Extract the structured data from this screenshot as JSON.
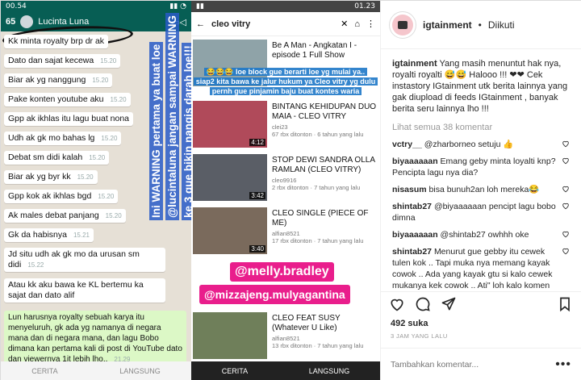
{
  "wa": {
    "time": "00.54",
    "title_num": "65",
    "contact": "Lucinta Luna",
    "messages": [
      {
        "text": "Kk minta royalty brp dr ak",
        "time": ""
      },
      {
        "text": "Dato dan sajat kecewa",
        "time": "15.20"
      },
      {
        "text": "Biar ak yg nanggung",
        "time": "15.20"
      },
      {
        "text": "Pake konten youtube aku",
        "time": "15.20"
      },
      {
        "text": "Gpp ak ikhlas itu lagu buat nona",
        "time": ""
      },
      {
        "text": "Udh ak gk mo bahas lg",
        "time": "15.20"
      },
      {
        "text": "Debat sm didi kalah",
        "time": "15.20"
      },
      {
        "text": "Biar ak yg byr kk",
        "time": "15.20"
      },
      {
        "text": "Gpp kok ak ikhlas bgd",
        "time": "15.20"
      },
      {
        "text": "Ak males debat panjang",
        "time": "15.20"
      },
      {
        "text": "Gk da habisnya",
        "time": "15.21"
      },
      {
        "text": "Jd situ udh ak gk mo da urusan sm didi",
        "time": "15.22"
      },
      {
        "text": "Atau kk aku bawa ke KL bertemu ka sajat dan dato alif",
        "time": ""
      }
    ],
    "reply": "Lun harusnya royalty sebuah karya itu menyeluruh, gk ada yg namanya di negara mana dan di negara mana, dan lagu Bobo dimana kan pertama kali di post di YouTube dato dan viewernya 1jt lebih lho..",
    "reply_time": "21.29",
    "warning_line1": "Ini WARNING pertama ya buat loe",
    "warning_line2": "@lucintaluna jangan sampai WARNING",
    "warning_line3": "ke 3 gue bikin nangis darah loe!!!",
    "bottom_left": "CERITA",
    "bottom_right": "LANGSUNG"
  },
  "yt": {
    "time": "01.23",
    "query": "cleo vitry",
    "overlay_line1": "😂😂😂 loe block gue berarti loe yg mulai ya..",
    "overlay_line2": "siap2 kita bawa ke jalur hukum ya Cleo vitry yg dulu",
    "overlay_line3": "pernh gue pinjamin baju buat kontes waria",
    "videos": [
      {
        "title": "Be A Man - Angkatan I - episode 1 Full Show",
        "meta": "",
        "duration": ""
      },
      {
        "title": "BINTANG KEHIDUPAN DUO MAIA - CLEO VITRY",
        "meta": "clei23\n67 rbx ditonton · 6 tahun yang lalu",
        "duration": "4:12"
      },
      {
        "title": "STOP DEWI SANDRA OLLA RAMLAN (CLEO VITRY)",
        "meta": "cleo9916\n2 rbx ditonton · 7 tahun yang lalu",
        "duration": "3:42"
      },
      {
        "title": "CLEO SINGLE (PIECE OF ME)",
        "meta": "alfian8521\n17 rbx ditonton · 7 tahun yang lalu",
        "duration": "3:40"
      },
      {
        "title": "CLEO FEAT SUSY (Whatever U Like)",
        "meta": "alfian8521\n13 rbx ditonton · 7 tahun yang lalu",
        "duration": ""
      }
    ],
    "tag1": "@melly.bradley",
    "tag2": "@mizzajeng.mulyagantina",
    "bottom_left": "CERITA",
    "bottom_right": "LANGSUNG"
  },
  "panel": {
    "username": "igtainment",
    "separator": "•",
    "follow": "Diikuti",
    "caption_user": "igtainment",
    "caption": "Yang masih menuntut hak nya, royalti royalti 😅😅 Halooo !!! ❤❤ Cek instastory IGtainment utk berita lainnya yang gak diupload di feeds IGtainment , banyak berita seru lainnya lho !!!",
    "more": "Lihat semua 38 komentar",
    "comments": [
      {
        "user": "vctry__",
        "text": "@zharborneo setuju 👍"
      },
      {
        "user": "biyaaaaaan",
        "text": "Emang geby minta loyalti knp? Pencipta lagu nya dia?"
      },
      {
        "user": "nisasum",
        "text": "bisa bunuh2an loh mereka😂"
      },
      {
        "user": "shintab27",
        "text": "@biyaaaaaan pencipt lagu bobo dimna"
      },
      {
        "user": "biyaaaaaan",
        "text": "@shintab27 owhhh oke"
      },
      {
        "user": "shintab27",
        "text": "Menurut gue gebby itu cewek tulen kok .. Tapi muka nya memang kayak cowok .. Ada yang kayak gtu si kalo cewek mukanya kek cowok .. Ati\" loh kalo komen gengsss"
      }
    ],
    "likes": "492 suka",
    "time": "3 JAM YANG LALU",
    "comment_placeholder": "Tambahkan komentar...",
    "more_icon": "•••"
  }
}
